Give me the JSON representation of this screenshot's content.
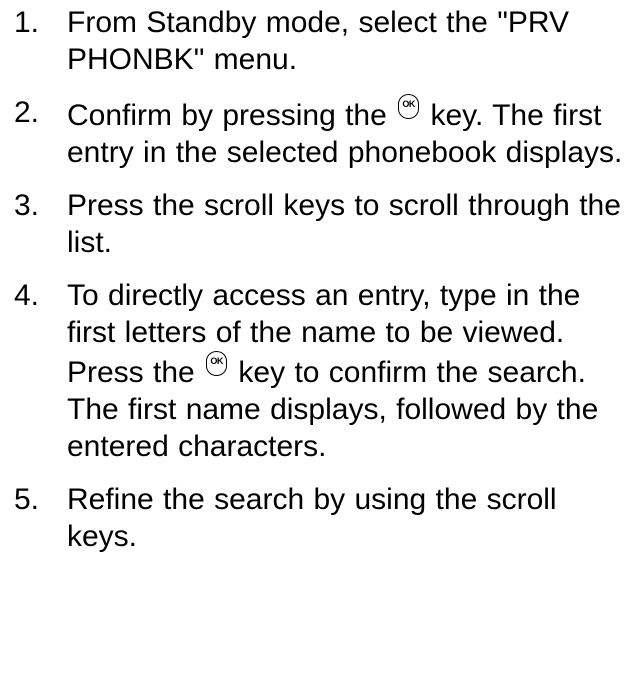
{
  "steps": [
    {
      "number": "1.",
      "text": "From Standby mode, select the \"PRV PHONBK\" menu."
    },
    {
      "number": "2.",
      "text_before": "Confirm by pressing the",
      "icon": "ok-key-icon",
      "icon_label": "OK",
      "text_after": "key. The first entry in the selected phonebook displays."
    },
    {
      "number": "3.",
      "text": "Press the scroll keys to scroll through the list."
    },
    {
      "number": "4.",
      "text_before": "To directly access an entry, type in the first letters of the name to be viewed. Press the",
      "icon": "ok-key-icon",
      "icon_label": "OK",
      "text_after": "key to confirm the search. The first name displays, followed by the entered characters."
    },
    {
      "number": "5.",
      "text": "Refine the search by using the scroll keys."
    }
  ]
}
